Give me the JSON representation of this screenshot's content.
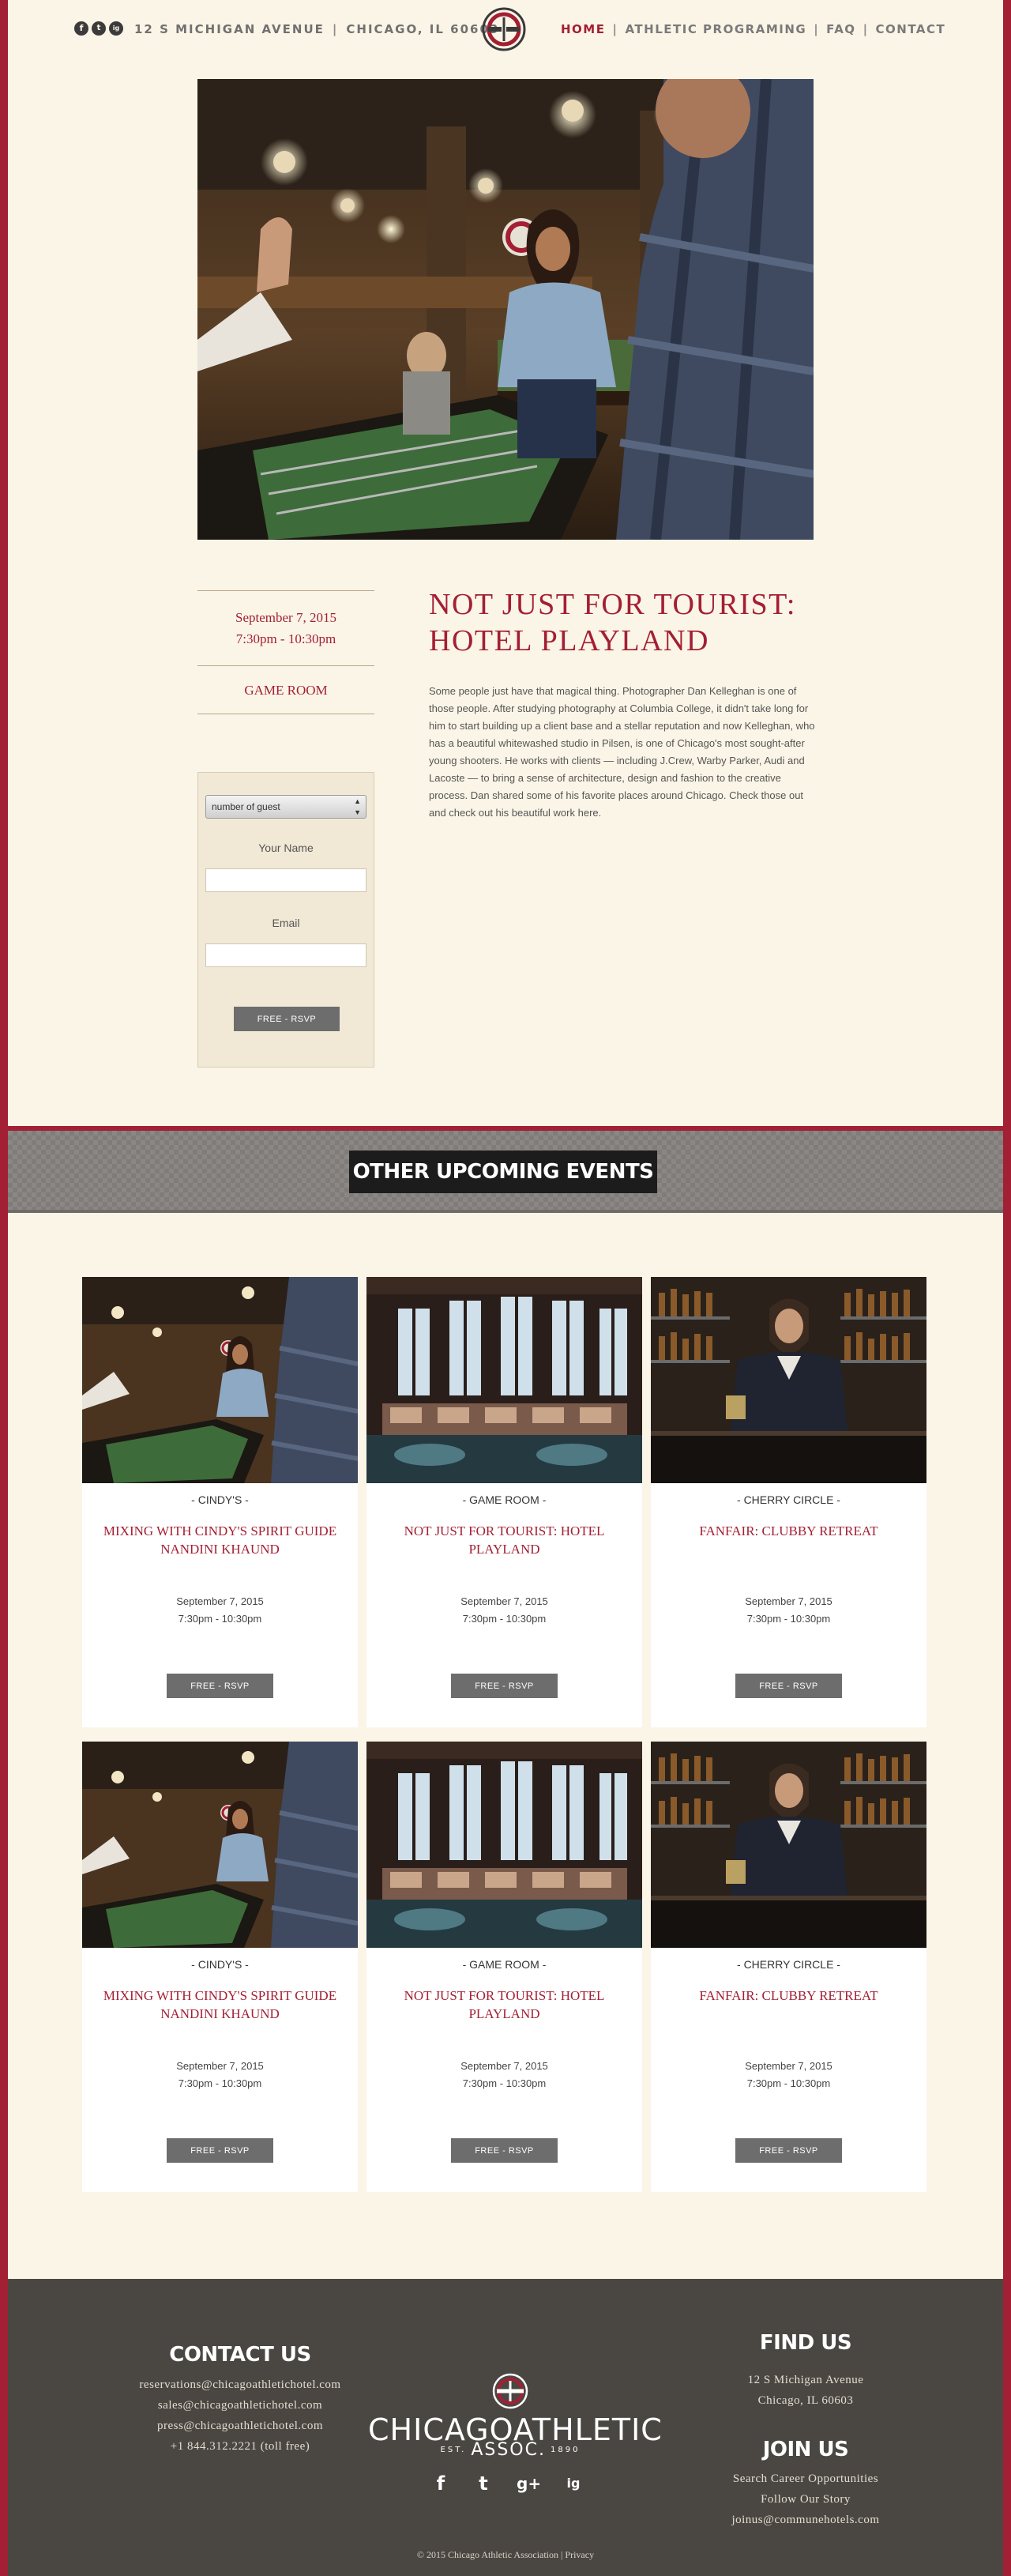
{
  "header": {
    "social": [
      "f",
      "t",
      "ig"
    ],
    "address": "12 S Michigan Avenue",
    "city": "Chicago, IL 60603",
    "nav": [
      {
        "label": "Home",
        "active": true
      },
      {
        "label": "Athletic Programing",
        "active": false
      },
      {
        "label": "FAQ",
        "active": false
      },
      {
        "label": "Contact",
        "active": false
      }
    ]
  },
  "event": {
    "date": "September 7, 2015",
    "time": "7:30pm - 10:30pm",
    "room": "Game Room",
    "title_line1": "Not just for tourist:",
    "title_line2": "hotel playland",
    "body": "Some people just have that magical thing. Photographer Dan Kelleghan is one of those people. After studying photography at Columbia College, it didn't take long for him to start building up a client base and a stellar reputation and now Kelleghan, who has a beautiful whitewashed studio in Pilsen, is one of Chicago's most sought-after young shooters. He works with clients — including J.Crew, Warby Parker, Audi and Lacoste — to bring a sense of architecture, design and fashion to the creative process. Dan shared some of his favorite places around Chicago. Check those out and check out his beautiful work here."
  },
  "rsvp": {
    "select_value": "number of guest",
    "name_label": "Your Name",
    "email_label": "Email",
    "button": "Free - RSVP"
  },
  "other_events": {
    "heading": "Other Upcoming Events",
    "cards": [
      {
        "venue": "- Cindy's -",
        "title": "Mixing with Cindy's spirit guide Nandini Khaund",
        "date": "September 7, 2015",
        "time": "7:30pm - 10:30pm",
        "button": "Free - RSVP",
        "image": "game-room-photo"
      },
      {
        "venue": "- Game Room -",
        "title": "Not just for tourist: hotel playland",
        "date": "September 7, 2015",
        "time": "7:30pm - 10:30pm",
        "button": "Free - RSVP",
        "image": "library-photo"
      },
      {
        "venue": "- Cherry Circle -",
        "title": "Fanfair: clubby retreat",
        "date": "September 7, 2015",
        "time": "7:30pm - 10:30pm",
        "button": "Free - RSVP",
        "image": "bartender-photo"
      },
      {
        "venue": "- Cindy's -",
        "title": "Mixing with Cindy's spirit guide Nandini Khaund",
        "date": "September 7, 2015",
        "time": "7:30pm - 10:30pm",
        "button": "Free - RSVP",
        "image": "game-room-photo"
      },
      {
        "venue": "- Game Room -",
        "title": "Not just for tourist: hotel playland",
        "date": "September 7, 2015",
        "time": "7:30pm - 10:30pm",
        "button": "Free - RSVP",
        "image": "library-photo"
      },
      {
        "venue": "- Cherry Circle -",
        "title": "Fanfair: clubby retreat",
        "date": "September 7, 2015",
        "time": "7:30pm - 10:30pm",
        "button": "Free - RSVP",
        "image": "bartender-photo"
      }
    ]
  },
  "footer": {
    "contact_heading": "Contact Us",
    "contact_lines": [
      "reservations@chicagoathletichotel.com",
      "sales@chicagoathletichotel.com",
      "press@chicagoathletichotel.com",
      "+1 844.312.2221 (toll free)"
    ],
    "find_heading": "Find Us",
    "find_lines": [
      "12 S Michigan Avenue",
      "Chicago, IL 60603"
    ],
    "join_heading": "Join Us",
    "join_lines": [
      "Search Career Opportunities",
      "Follow Our Story",
      "joinus@communehotels.com"
    ],
    "brand": "ChicagoAthletic",
    "brand_est": "Est.",
    "brand_assoc": "Assoc.",
    "brand_year": "1890",
    "social": [
      "f",
      "t",
      "g+",
      "ig"
    ],
    "copyright": "© 2015 Chicago Athletic Association | Privacy"
  },
  "colors": {
    "accent": "#a31f34",
    "cream": "#fbf5e7",
    "footer": "#4a4743",
    "button": "#6d6d6d"
  }
}
